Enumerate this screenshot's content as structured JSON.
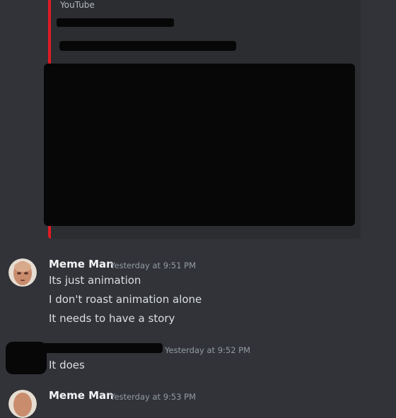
{
  "embed": {
    "provider": "YouTube",
    "accent_color": "#e01b24"
  },
  "messages": [
    {
      "author": "Meme Man",
      "timestamp": "Yesterday at 9:51 PM",
      "lines": [
        "Its just animation",
        "I don't roast animation alone",
        "It needs to have a story"
      ]
    },
    {
      "author": "",
      "timestamp": "Yesterday at 9:52 PM",
      "lines": [
        "It does"
      ]
    },
    {
      "author": "Meme Man",
      "timestamp": "Yesterday at 9:53 PM",
      "lines": []
    }
  ]
}
